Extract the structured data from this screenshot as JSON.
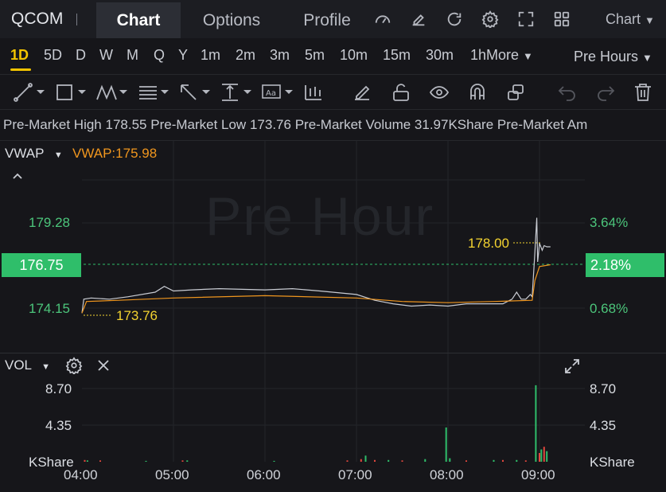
{
  "header": {
    "ticker": "QCOM",
    "tabs": [
      {
        "label": "Chart",
        "active": true
      },
      {
        "label": "Options",
        "active": false
      },
      {
        "label": "Profile",
        "active": false
      }
    ],
    "icons": [
      "gauge-icon",
      "edit-icon",
      "refresh-icon",
      "settings-icon",
      "fullscreen-icon",
      "grid-icon"
    ],
    "chart_dropdown": "Chart"
  },
  "timeframes": {
    "items": [
      "1D",
      "5D",
      "D",
      "W",
      "M",
      "Q",
      "Y",
      "1m",
      "2m",
      "3m",
      "5m",
      "10m",
      "15m",
      "30m",
      "1h"
    ],
    "active": "1D",
    "more_label": "More",
    "session_label": "Pre Hours"
  },
  "info": {
    "high_label": "Pre-Market High",
    "high_value": "178.55",
    "low_label": "Pre-Market Low",
    "low_value": "173.76",
    "volume_label": "Pre-Market Volume",
    "volume_value": "31.97KShare",
    "amount_label": "Pre-Market Am"
  },
  "chart": {
    "indicator_label": "VWAP",
    "indicator_value": "VWAP:175.98",
    "watermark": "Pre Hour",
    "price_axis": [
      "179.28",
      "176.75",
      "174.15"
    ],
    "pct_axis": [
      "3.64%",
      "2.18%",
      "0.68%"
    ],
    "current_price": "176.75",
    "current_pct": "2.18%",
    "high_annotation": "178.00",
    "low_annotation": "173.76",
    "colors": {
      "up": "#2fbe6a",
      "vwap": "#f0961e",
      "annotation": "#f3d330",
      "price_line": "#c9ccd3"
    }
  },
  "volume": {
    "indicator_label": "VOL",
    "axis_left": [
      "8.70",
      "4.35",
      "KShare"
    ],
    "axis_right": [
      "8.70",
      "4.35",
      "KShare"
    ],
    "time_labels": [
      "04:00",
      "05:00",
      "06:00",
      "07:00",
      "08:00",
      "09:00"
    ]
  },
  "chart_data": {
    "type": "line",
    "x_label_ticks": [
      "04:00",
      "05:00",
      "06:00",
      "07:00",
      "08:00",
      "09:00"
    ],
    "ylim": [
      172.2,
      181.3
    ],
    "series": [
      {
        "values": [
          [
            4.0,
            173.9
          ],
          [
            4.02,
            174.5
          ],
          [
            4.1,
            174.55
          ],
          [
            4.3,
            174.5
          ],
          [
            4.5,
            174.6
          ],
          [
            4.8,
            174.8
          ],
          [
            4.9,
            175.05
          ],
          [
            5.0,
            174.85
          ],
          [
            5.2,
            174.9
          ],
          [
            5.5,
            174.95
          ],
          [
            6.0,
            174.9
          ],
          [
            6.3,
            174.95
          ],
          [
            6.6,
            174.85
          ],
          [
            7.0,
            174.7
          ],
          [
            7.2,
            174.45
          ],
          [
            7.4,
            174.3
          ],
          [
            7.6,
            174.2
          ],
          [
            7.8,
            174.25
          ],
          [
            8.0,
            174.2
          ],
          [
            8.2,
            174.3
          ],
          [
            8.4,
            174.3
          ],
          [
            8.6,
            174.3
          ],
          [
            8.7,
            174.5
          ],
          [
            8.75,
            174.8
          ],
          [
            8.8,
            174.5
          ],
          [
            8.85,
            174.5
          ],
          [
            8.9,
            174.7
          ],
          [
            8.92,
            174.6
          ],
          [
            8.95,
            176.5
          ],
          [
            8.97,
            178.0
          ],
          [
            8.98,
            176.1
          ],
          [
            9.0,
            176.9
          ],
          [
            9.03,
            176.6
          ],
          [
            9.05,
            176.8
          ],
          [
            9.08,
            176.75
          ],
          [
            9.12,
            176.75
          ]
        ]
      },
      {
        "values": [
          [
            4.0,
            173.9
          ],
          [
            4.05,
            174.4
          ],
          [
            4.4,
            174.45
          ],
          [
            5.0,
            174.55
          ],
          [
            6.0,
            174.65
          ],
          [
            7.0,
            174.55
          ],
          [
            7.5,
            174.4
          ],
          [
            8.0,
            174.35
          ],
          [
            8.5,
            174.4
          ],
          [
            8.92,
            174.45
          ],
          [
            8.95,
            175.3
          ],
          [
            9.0,
            175.9
          ],
          [
            9.12,
            175.98
          ]
        ]
      }
    ],
    "volume": {
      "ylim": [
        0,
        10.5
      ],
      "bars": [
        [
          4.03,
          0.2,
          "down"
        ],
        [
          4.06,
          0.15,
          "up"
        ],
        [
          4.2,
          0.15,
          "down"
        ],
        [
          4.7,
          0.1,
          "up"
        ],
        [
          5.1,
          0.15,
          "down"
        ],
        [
          5.15,
          0.15,
          "up"
        ],
        [
          6.1,
          0.1,
          "up"
        ],
        [
          6.9,
          0.15,
          "down"
        ],
        [
          7.05,
          0.3,
          "down"
        ],
        [
          7.1,
          0.7,
          "up"
        ],
        [
          7.2,
          0.2,
          "down"
        ],
        [
          7.35,
          0.2,
          "up"
        ],
        [
          7.5,
          0.15,
          "down"
        ],
        [
          7.75,
          0.3,
          "up"
        ],
        [
          7.98,
          3.9,
          "up"
        ],
        [
          8.02,
          0.4,
          "up"
        ],
        [
          8.2,
          0.15,
          "down"
        ],
        [
          8.5,
          0.2,
          "up"
        ],
        [
          8.6,
          0.2,
          "down"
        ],
        [
          8.75,
          0.2,
          "up"
        ],
        [
          8.85,
          0.15,
          "down"
        ],
        [
          8.96,
          8.7,
          "up"
        ],
        [
          9.0,
          1.0,
          "down"
        ],
        [
          9.02,
          1.4,
          "up"
        ],
        [
          9.05,
          1.7,
          "down"
        ],
        [
          9.08,
          1.2,
          "up"
        ]
      ]
    }
  }
}
